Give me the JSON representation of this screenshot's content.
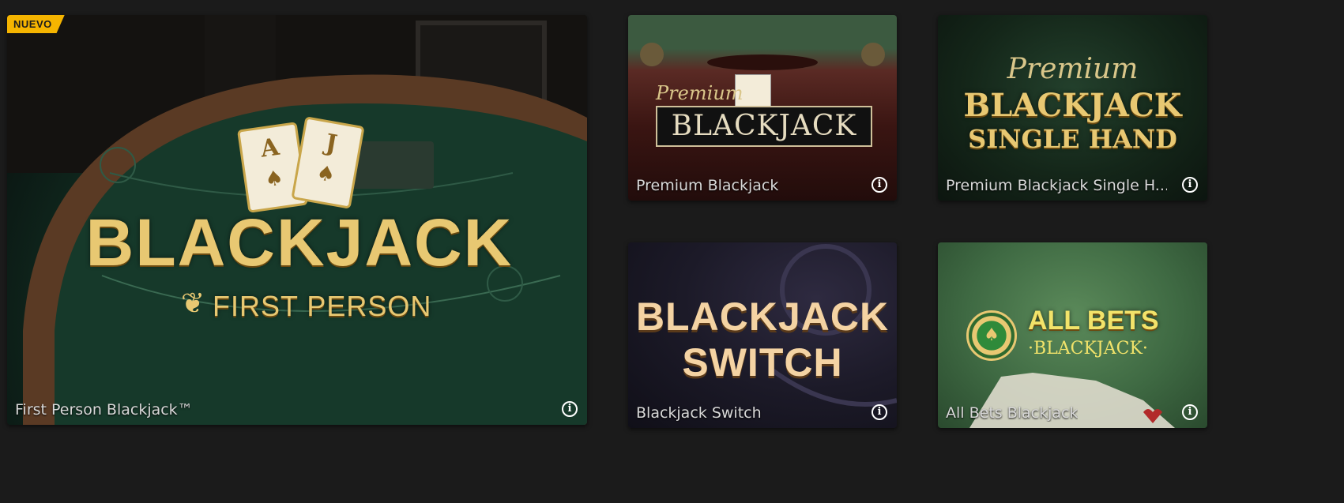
{
  "badge": "NUEVO",
  "tiles": [
    {
      "title": "First Person Blackjack™",
      "logo": {
        "line1": "BLACKJACK",
        "line2": "FIRST PERSON",
        "card1": "A",
        "card2": "J"
      }
    },
    {
      "title": "Premium Blackjack",
      "logo": {
        "script": "Premium",
        "main": "BLACKJACK"
      }
    },
    {
      "title": "Premium Blackjack Single H...",
      "logo": {
        "script": "Premium",
        "line1": "BLACKJACK",
        "line2": "SINGLE HAND"
      }
    },
    {
      "title": "Blackjack Switch",
      "logo": {
        "line1": "BLACKJACK",
        "line2": "SWITCH"
      }
    },
    {
      "title": "All Bets Blackjack",
      "logo": {
        "line1": "ALL BETS",
        "line2": "·BLACKJACK·"
      }
    }
  ],
  "info_glyph": "i",
  "icons": [
    "info-icon",
    "spade-icon",
    "leaf-icon",
    "chip-icon"
  ],
  "colors": {
    "badge": "#f5b400",
    "gold": "#e8c872",
    "background": "#1b1b1b"
  }
}
